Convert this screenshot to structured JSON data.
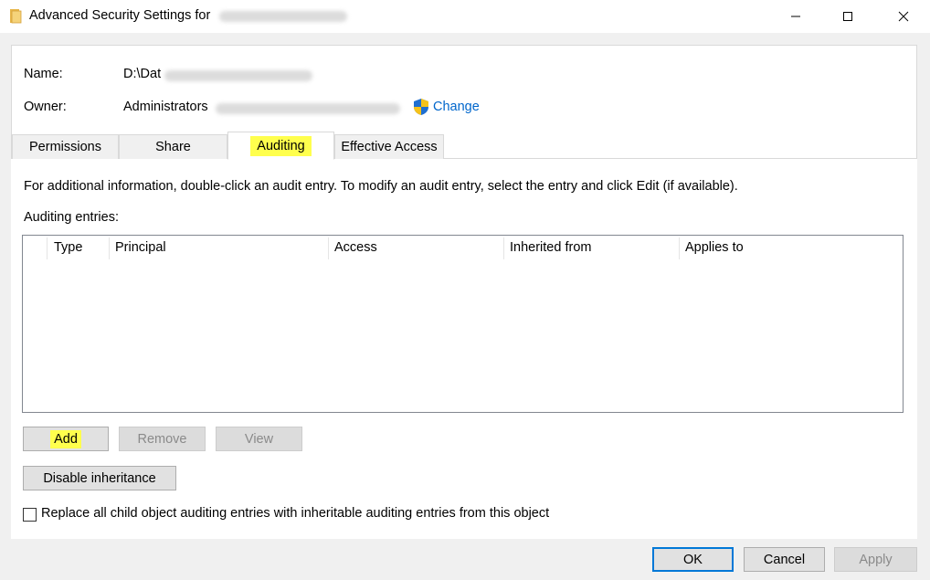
{
  "window": {
    "title": "Advanced Security Settings for",
    "icon": "folder-icon",
    "controls": [
      "minimize-icon",
      "maximize-icon",
      "close-icon"
    ]
  },
  "info": {
    "name_label": "Name:",
    "name_value": "D:\\Dat",
    "owner_label": "Owner:",
    "owner_value": "Administrators",
    "change_link": "Change"
  },
  "tabs": [
    {
      "label": "Permissions",
      "selected": false
    },
    {
      "label": "Share",
      "selected": false
    },
    {
      "label": "Auditing",
      "selected": true
    },
    {
      "label": "Effective Access",
      "selected": false
    }
  ],
  "auditing": {
    "description": "For additional information, double-click an audit entry. To modify an audit entry, select the entry and click Edit (if available).",
    "entries_label": "Auditing entries:",
    "columns": [
      "Type",
      "Principal",
      "Access",
      "Inherited from",
      "Applies to"
    ],
    "rows": [],
    "add_label": "Add",
    "remove_label": "Remove",
    "view_label": "View",
    "disable_inheritance_label": "Disable inheritance",
    "replace_checkbox_label": "Replace all child object auditing entries with inheritable auditing entries from this object",
    "replace_checked": false
  },
  "footer": {
    "ok_label": "OK",
    "cancel_label": "Cancel",
    "apply_label": "Apply"
  },
  "colors": {
    "highlight": "#ffff4d",
    "link": "#0066cc",
    "focus_border": "#0078d7"
  }
}
